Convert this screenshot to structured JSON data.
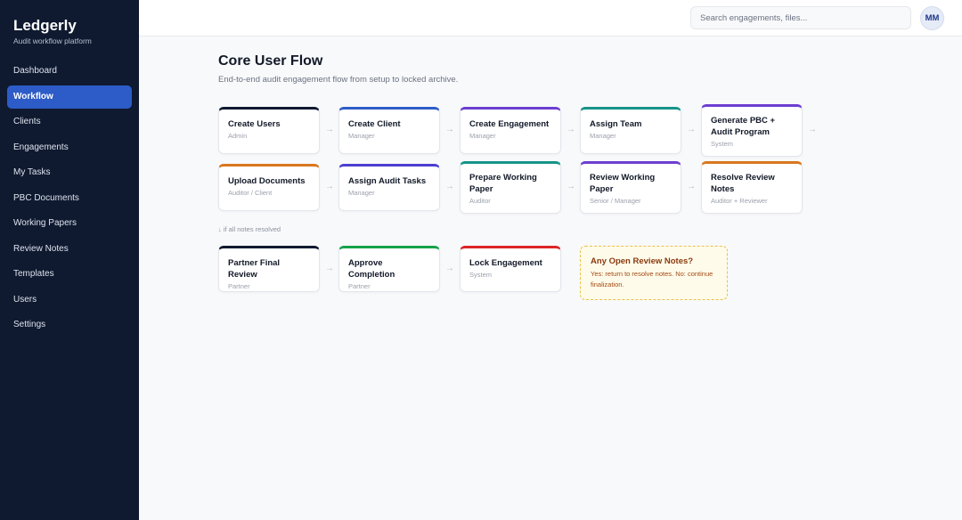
{
  "app": {
    "brand": "Ledgerly",
    "tagline": "Audit workflow platform"
  },
  "sidebar": {
    "items": [
      {
        "label": "Dashboard"
      },
      {
        "label": "Workflow",
        "active": true
      },
      {
        "label": "Clients"
      },
      {
        "label": "Engagements"
      },
      {
        "label": "My Tasks"
      },
      {
        "label": "PBC Documents"
      },
      {
        "label": "Working Papers"
      },
      {
        "label": "Review Notes"
      },
      {
        "label": "Templates"
      },
      {
        "label": "Users"
      },
      {
        "label": "Settings"
      }
    ]
  },
  "topbar": {
    "search_placeholder": "Search engagements, files...",
    "avatar_initials": "MM"
  },
  "main": {
    "title": "Core User Flow",
    "subtitle": "End-to-end audit engagement flow from setup to locked archive.",
    "branch_note": "↓ if all notes resolved",
    "steps": [
      {
        "title": "Create Users",
        "role": "Admin",
        "color": "#0f1a30"
      },
      {
        "title": "Create Client",
        "role": "Manager",
        "color": "#2d5cc8"
      },
      {
        "title": "Create Engagement",
        "role": "Manager",
        "color": "#6d3fd1"
      },
      {
        "title": "Assign Team",
        "role": "Manager",
        "color": "#169488"
      },
      {
        "title": "Generate PBC + Audit Program",
        "role": "System",
        "color": "#6d3fd1"
      },
      {
        "title": "Upload Documents",
        "role": "Auditor / Client",
        "color": "#d9771e"
      },
      {
        "title": "Assign Audit Tasks",
        "role": "Manager",
        "color": "#4b3fd1"
      },
      {
        "title": "Prepare Working Paper",
        "role": "Auditor",
        "color": "#169488"
      },
      {
        "title": "Review Working Paper",
        "role": "Senior / Manager",
        "color": "#6d3fd1"
      },
      {
        "title": "Resolve Review Notes",
        "role": "Auditor + Reviewer",
        "color": "#d9771e"
      },
      {
        "title": "Partner Final Review",
        "role": "Partner",
        "color": "#0f1a30"
      },
      {
        "title": "Approve Completion",
        "role": "Partner",
        "color": "#16a34a"
      },
      {
        "title": "Lock Engagement",
        "role": "System",
        "color": "#dc2626"
      }
    ],
    "decision": {
      "title": "Any Open Review Notes?",
      "body": "Yes: return to resolve notes. No: continue finalization."
    }
  },
  "icons": {
    "arrow": "right-arrow-icon",
    "arrow_glyph": "→"
  }
}
